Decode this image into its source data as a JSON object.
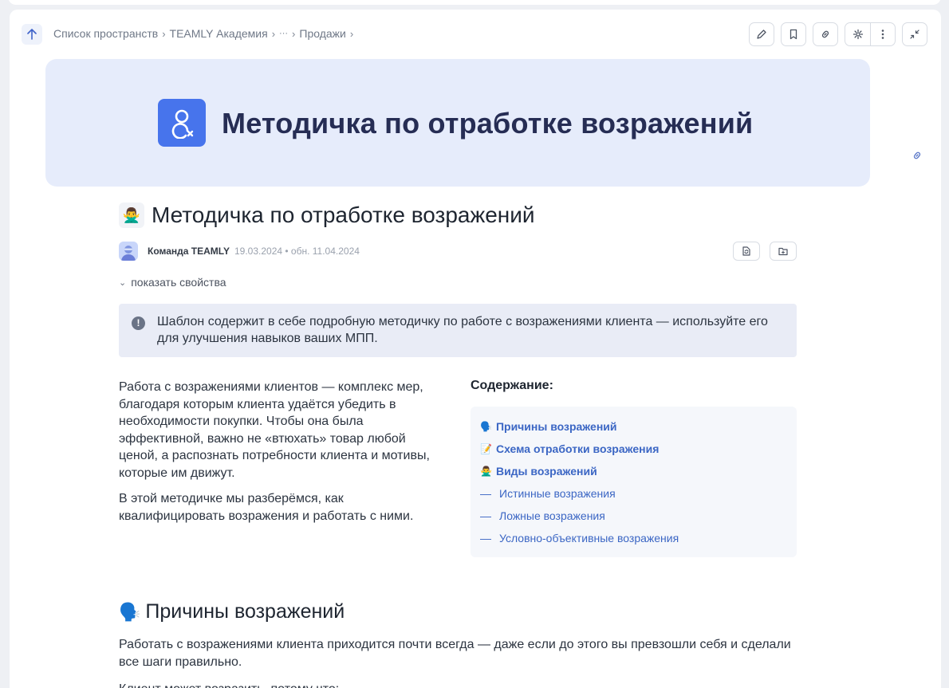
{
  "breadcrumb": {
    "items": [
      "Список пространств",
      "TEAMLY Академия",
      "···",
      "Продажи"
    ]
  },
  "toolbar": {
    "icons": [
      "pencil-icon",
      "bookmark-icon",
      "link-icon",
      "gear-icon",
      "more-vertical-icon",
      "collapse-icon"
    ]
  },
  "cover": {
    "title": "Методичка по отработке возражений",
    "icon": "user-cross-icon",
    "accent": "#4774ec"
  },
  "page": {
    "emoji": "🙅‍♂️",
    "title": "Методичка по отработке возражений",
    "author": "Команда TEAMLY",
    "dates": "19.03.2024 • обн. 11.04.2024",
    "show_properties": "показать свойства"
  },
  "callout": {
    "text": "Шаблон содержит в себе подробную методичку по работе с возражениями клиента — используйте его для улучшения навыков ваших МПП."
  },
  "intro": {
    "p1": "Работа с возражениями клиентов — комплекс мер, благодаря которым клиента удаётся убедить в необходимости покупки. Чтобы она была эффективной, важно не «втюхать» товар любой ценой, а распознать потребности клиента и мотивы, которые им движут.",
    "p2": "В этой методичке мы разберёмся, как квалифицировать возражения и работать с ними."
  },
  "toc": {
    "heading": "Содержание:",
    "items": [
      {
        "emoji": "🗣️",
        "label": "Причины возражений"
      },
      {
        "emoji": "📝",
        "label": "Схема отработки возражения"
      },
      {
        "emoji": "🙅‍♂️",
        "label": "Виды возражений"
      },
      {
        "dash": "—",
        "label": "Истинные возражения"
      },
      {
        "dash": "—",
        "label": "Ложные возражения"
      },
      {
        "dash": "—",
        "label": "Условно-объективные возражения"
      }
    ]
  },
  "section1": {
    "emoji": "🗣️",
    "title": "Причины возражений",
    "p1": "Работать с возражениями клиента приходится почти всегда — даже если до этого вы превзошли себя и сделали все шаги правильно.",
    "p2": "Клиент может возразить, потому что:"
  }
}
